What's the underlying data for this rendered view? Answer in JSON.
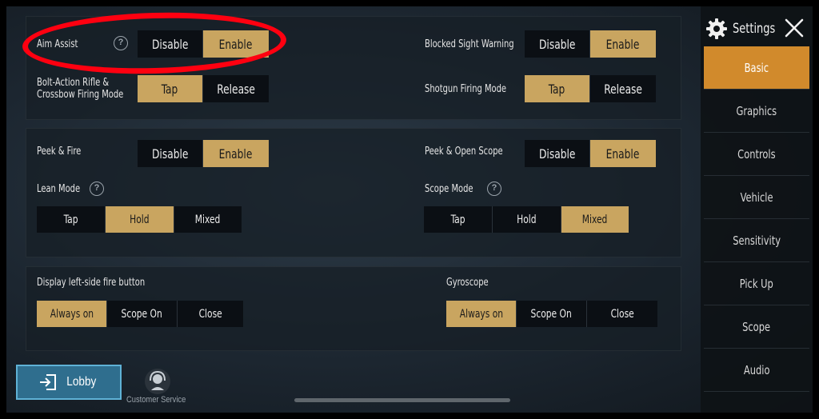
{
  "colors": {
    "accent": "#c9a560",
    "nav_active": "#d18a2c",
    "annotation": "#ff0010"
  },
  "section1": {
    "aim_assist": {
      "label": "Aim Assist",
      "options": [
        "Disable",
        "Enable"
      ],
      "selected": "Enable"
    },
    "blocked_sight": {
      "label": "Blocked Sight Warning",
      "options": [
        "Disable",
        "Enable"
      ],
      "selected": "Enable"
    },
    "bolt_action": {
      "label": "Bolt-Action Rifle &\nCrossbow Firing Mode",
      "options": [
        "Tap",
        "Release"
      ],
      "selected": "Tap"
    },
    "shotgun": {
      "label": "Shotgun Firing Mode",
      "options": [
        "Tap",
        "Release"
      ],
      "selected": "Tap"
    }
  },
  "section2": {
    "peek_fire": {
      "label": "Peek & Fire",
      "options": [
        "Disable",
        "Enable"
      ],
      "selected": "Enable"
    },
    "peek_scope": {
      "label": "Peek & Open Scope",
      "options": [
        "Disable",
        "Enable"
      ],
      "selected": "Enable"
    },
    "lean_mode": {
      "label": "Lean Mode",
      "options": [
        "Tap",
        "Hold",
        "Mixed"
      ],
      "selected": "Hold"
    },
    "scope_mode": {
      "label": "Scope Mode",
      "options": [
        "Tap",
        "Hold",
        "Mixed"
      ],
      "selected": "Mixed"
    }
  },
  "section3": {
    "left_fire": {
      "label": "Display left-side fire button",
      "options": [
        "Always on",
        "Scope On",
        "Close"
      ],
      "selected": "Always on"
    },
    "gyroscope": {
      "label": "Gyroscope",
      "options": [
        "Always on",
        "Scope On",
        "Close"
      ],
      "selected": "Always on"
    }
  },
  "sidebar": {
    "title": "Settings",
    "items": [
      {
        "label": "Basic",
        "active": true
      },
      {
        "label": "Graphics"
      },
      {
        "label": "Controls"
      },
      {
        "label": "Vehicle"
      },
      {
        "label": "Sensitivity"
      },
      {
        "label": "Pick Up"
      },
      {
        "label": "Scope"
      },
      {
        "label": "Audio"
      }
    ]
  },
  "bottom": {
    "lobby_label": "Lobby",
    "customer_service_label": "Customer Service"
  },
  "help_glyph": "?",
  "icons": [
    "gear-icon",
    "close-icon",
    "exit-icon",
    "headset-icon",
    "help-icon"
  ]
}
